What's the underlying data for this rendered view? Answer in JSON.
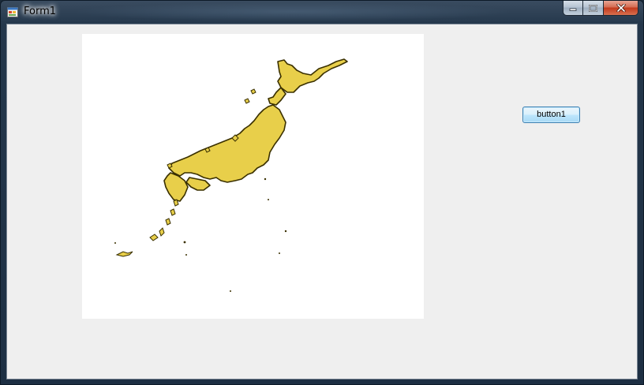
{
  "window": {
    "title": "Form1",
    "icon": "form-app-icon",
    "controls": {
      "minimize": "minimize-icon",
      "maximize": "maximize-icon",
      "close": "close-icon"
    }
  },
  "form": {
    "button1_label": "button1",
    "picture": {
      "content": "map-of-japan",
      "fill_color": "#e8cf4a",
      "outline_color": "#3a3000",
      "background": "#ffffff"
    }
  }
}
